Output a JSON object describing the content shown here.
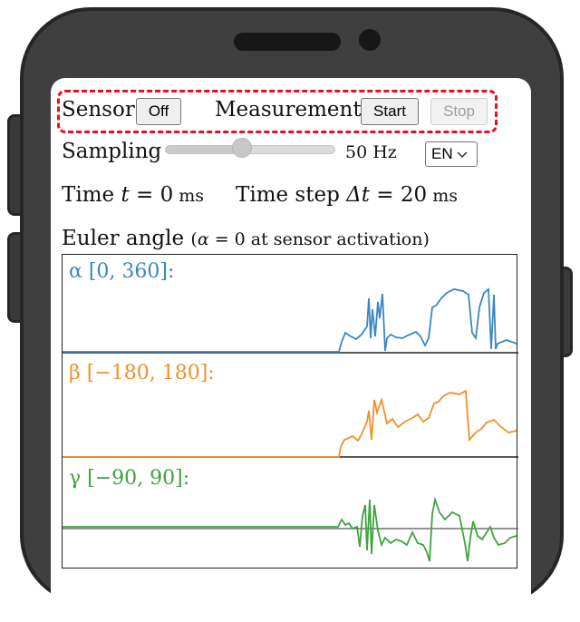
{
  "controls": {
    "sensor_label": "Sensor",
    "sensor_button": "Off",
    "measurement_label": "Measurement",
    "start_button": "Start",
    "stop_button": "Stop"
  },
  "sampling": {
    "label": "Sampling",
    "value_text": "50 Hz",
    "slider_fraction": 0.45,
    "language": "EN"
  },
  "time": {
    "time_prefix": "Time ",
    "time_var": "t",
    "time_value": " = 0",
    "time_unit": " ms",
    "step_prefix": "Time step ",
    "step_var": "Δt",
    "step_value": " = 20",
    "step_unit": " ms"
  },
  "plot": {
    "title": "Euler angle",
    "note_open": "(",
    "note_var": "α",
    "note_rest": " = 0 at sensor activation)",
    "alpha_label": "α [0, 360]:",
    "beta_label": "β [−180, 180]:",
    "gamma_label": "γ [−90, 90]:",
    "colors": {
      "alpha": "#3a87c2",
      "beta": "#f0902b",
      "gamma": "#3ea33e"
    }
  }
}
